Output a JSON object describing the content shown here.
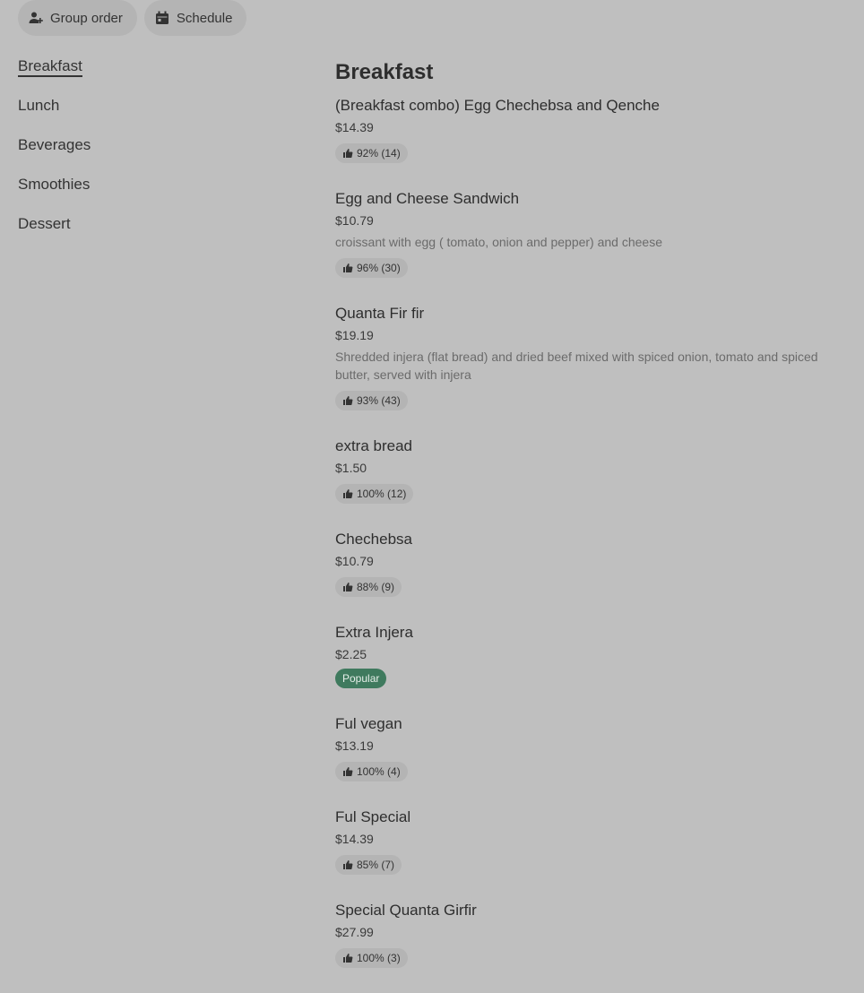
{
  "topbar": {
    "group_order_label": "Group order",
    "schedule_label": "Schedule"
  },
  "sidebar": {
    "items": [
      {
        "label": "Breakfast",
        "active": true
      },
      {
        "label": "Lunch"
      },
      {
        "label": "Beverages"
      },
      {
        "label": "Smoothies"
      },
      {
        "label": "Dessert"
      }
    ]
  },
  "main": {
    "section_title": "Breakfast",
    "items": [
      {
        "name": "(Breakfast combo) Egg Chechebsa and Qenche",
        "price": "$14.39",
        "rating": "92% (14)"
      },
      {
        "name": "Egg and Cheese Sandwich",
        "price": "$10.79",
        "description": "croissant with egg ( tomato, onion and pepper) and cheese",
        "rating": "96% (30)"
      },
      {
        "name": "Quanta Fir fir",
        "price": "$19.19",
        "description": "Shredded injera (flat bread) and dried beef mixed with spiced onion, tomato and spiced butter, served with injera",
        "rating": "93% (43)"
      },
      {
        "name": "extra bread",
        "price": "$1.50",
        "rating": "100% (12)"
      },
      {
        "name": "Chechebsa",
        "price": "$10.79",
        "rating": "88% (9)"
      },
      {
        "name": "Extra Injera",
        "price": "$2.25",
        "badge": "Popular"
      },
      {
        "name": "Ful vegan",
        "price": "$13.19",
        "rating": "100% (4)"
      },
      {
        "name": "Ful Special",
        "price": "$14.39",
        "rating": "85% (7)"
      },
      {
        "name": "Special Quanta Girfir",
        "price": "$27.99",
        "rating": "100% (3)"
      }
    ]
  }
}
